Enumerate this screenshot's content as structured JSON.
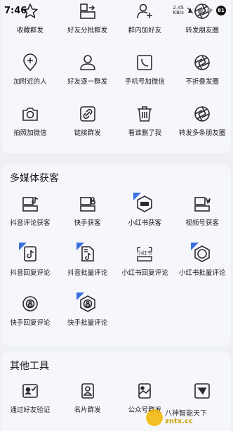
{
  "status_bar": {
    "time": "7:46",
    "speed_value": "2.45",
    "speed_unit": "KB/s",
    "battery": "81"
  },
  "section_share": {
    "items": [
      {
        "label": "收藏群发",
        "icon": "star-icon"
      },
      {
        "label": "好友分批群发",
        "icon": "batch-send-icon"
      },
      {
        "label": "群内加好友",
        "icon": "add-friend-icon"
      },
      {
        "label": "转发朋友圈",
        "icon": "aperture-icon"
      },
      {
        "label": "加附近的人",
        "icon": "location-pin-icon"
      },
      {
        "label": "好友逐一群发",
        "icon": "person-icon"
      },
      {
        "label": "手机号加微信",
        "icon": "phone-icon"
      },
      {
        "label": "不折叠发圈",
        "icon": "aperture-icon"
      },
      {
        "label": "拍照加微信",
        "icon": "camera-icon"
      },
      {
        "label": "链接群发",
        "icon": "link-icon"
      },
      {
        "label": "看谁删了我",
        "icon": "trash-icon"
      },
      {
        "label": "转发多条朋友圈",
        "icon": "aperture-icon"
      }
    ]
  },
  "section_media": {
    "title": "多媒体获客",
    "items": [
      {
        "label": "抖音评论获客",
        "icon": "douyin-screen-icon",
        "badge": false
      },
      {
        "label": "快手获客",
        "icon": "kuaishou-screen-icon",
        "badge": false
      },
      {
        "label": "小红书获客",
        "icon": "xiaohongshu-hex-icon",
        "badge": true
      },
      {
        "label": "视频号获客",
        "icon": "channels-screen-icon",
        "badge": false
      },
      {
        "label": "抖音回复评论",
        "icon": "douyin-doc-icon",
        "badge": true
      },
      {
        "label": "抖音批量评论",
        "icon": "douyin-file-icon",
        "badge": true
      },
      {
        "label": "小红书回复评论",
        "icon": "xiaohongshu-text-icon",
        "badge": false
      },
      {
        "label": "小红书批量评论",
        "icon": "xiaohongshu-hex-icon",
        "badge": true
      },
      {
        "label": "快手回复评论",
        "icon": "kuaishou-circle-icon",
        "badge": false
      },
      {
        "label": "快手批量评论",
        "icon": "kuaishou-hex-icon",
        "badge": true
      }
    ],
    "xhs_logo_text": "小红书"
  },
  "section_other": {
    "title": "其他工具",
    "items": [
      {
        "label": "通过好友验证",
        "icon": "verify-icon"
      },
      {
        "label": "名片群发",
        "icon": "card-icon"
      },
      {
        "label": "公众号群发",
        "icon": "image-doc-icon"
      },
      {
        "label": "",
        "icon": "send-box-icon"
      }
    ]
  },
  "watermark": {
    "line1": "八神智能天下",
    "line2": "zntx.cc"
  },
  "colors": {
    "background": "#eef0f6",
    "card": "#f6f7fc",
    "accent": "#3a6fe0",
    "icon_stroke": "#2a2a30"
  }
}
